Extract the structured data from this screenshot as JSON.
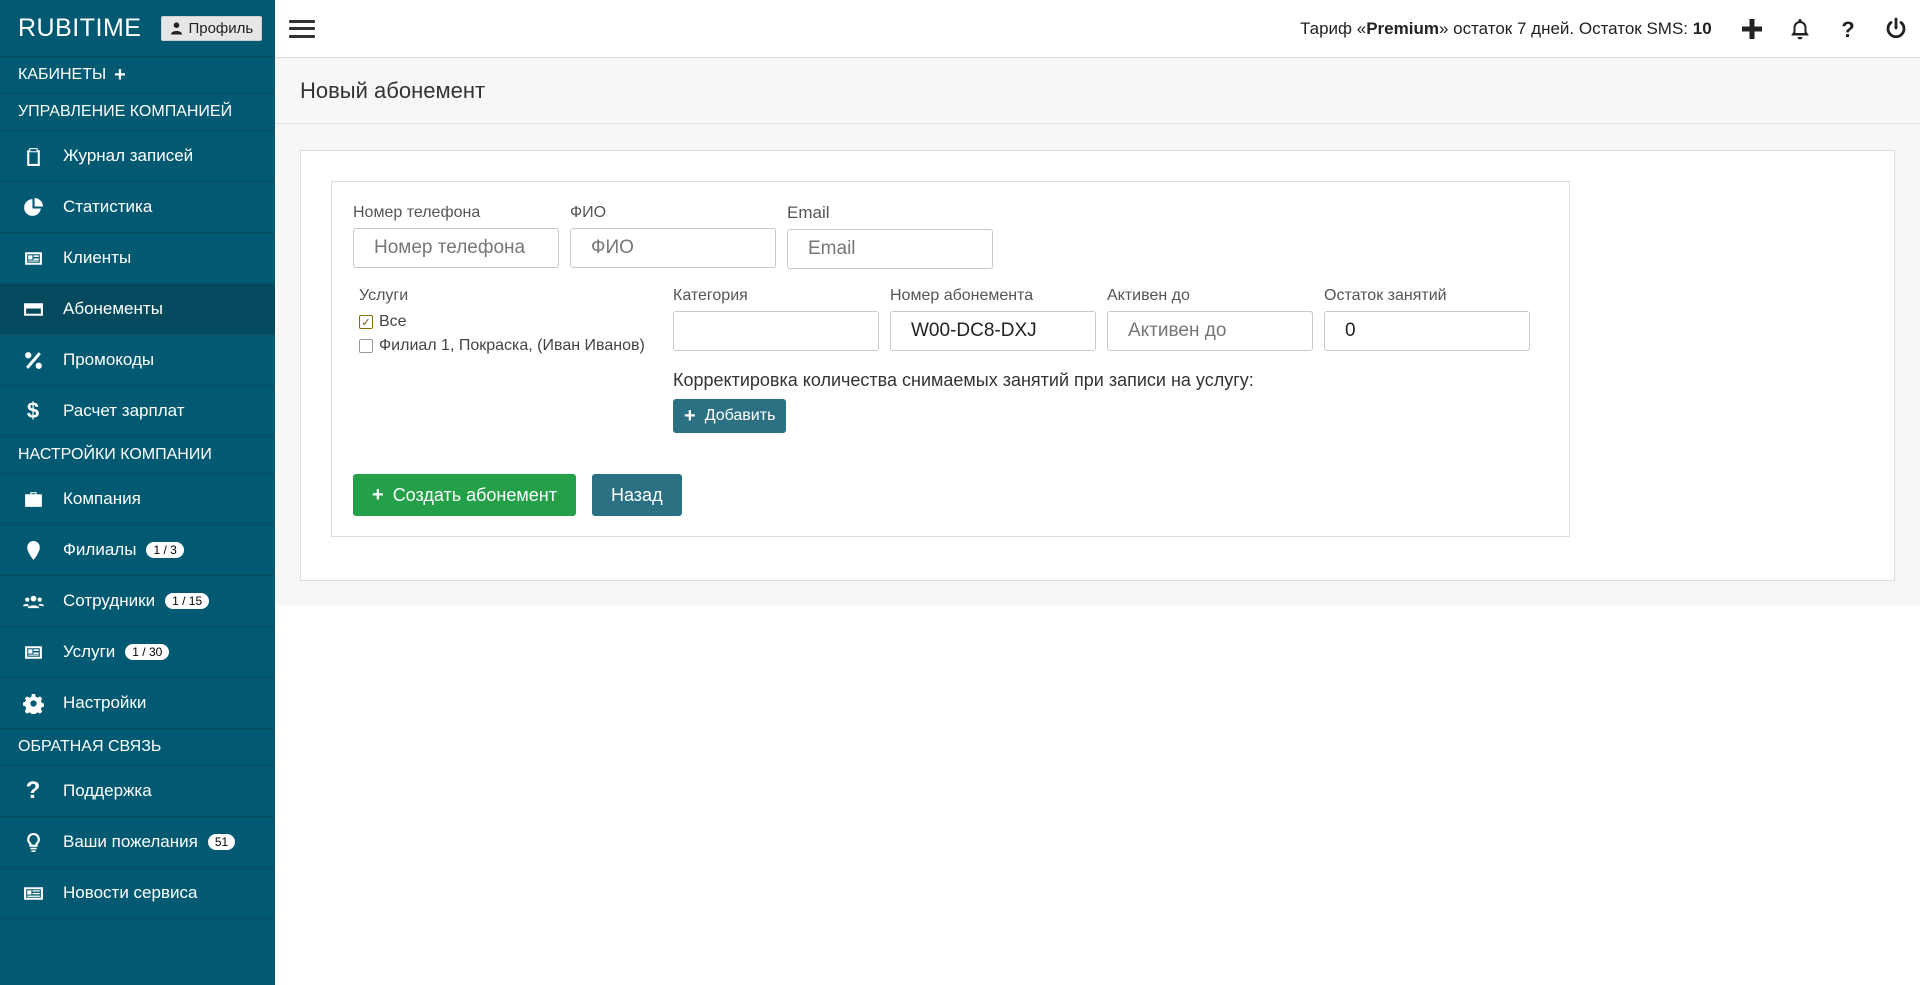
{
  "sidebar": {
    "brand": "RUBITIME",
    "profile_label": "Профиль",
    "cabinets_label": "КАБИНЕТЫ",
    "sections": [
      {
        "title": "УПРАВЛЕНИЕ КОМПАНИЕЙ",
        "items": [
          {
            "label": "Журнал записей",
            "icon": "clipboard-icon"
          },
          {
            "label": "Статистика",
            "icon": "pie-chart-icon"
          },
          {
            "label": "Клиенты",
            "icon": "id-card-icon"
          },
          {
            "label": "Абонементы",
            "icon": "credit-card-icon",
            "active": true
          },
          {
            "label": "Промокоды",
            "icon": "percent-icon"
          },
          {
            "label": "Расчет зарплат",
            "icon": "dollar-icon"
          }
        ]
      },
      {
        "title": "НАСТРОЙКИ КОМПАНИИ",
        "items": [
          {
            "label": "Компания",
            "icon": "briefcase-icon"
          },
          {
            "label": "Филиалы",
            "icon": "map-marker-icon",
            "badge": "1 / 3"
          },
          {
            "label": "Сотрудники",
            "icon": "users-icon",
            "badge": "1 / 15"
          },
          {
            "label": "Услуги",
            "icon": "id-card-icon",
            "badge": "1 / 30"
          },
          {
            "label": "Настройки",
            "icon": "gear-icon"
          }
        ]
      },
      {
        "title": "ОБРАТНАЯ СВЯЗЬ",
        "items": [
          {
            "label": "Поддержка",
            "icon": "question-icon"
          },
          {
            "label": "Ваши пожелания",
            "icon": "lightbulb-icon",
            "badge": "51"
          },
          {
            "label": "Новости сервиса",
            "icon": "newspaper-icon"
          }
        ]
      }
    ]
  },
  "topbar": {
    "tariff_prefix": "Тариф «",
    "tariff_name": "Premium",
    "tariff_suffix": "» остаток 7 дней. Остаток SMS: ",
    "sms_count": "10",
    "icons": [
      "plus-icon",
      "bell-icon",
      "question-icon",
      "power-icon"
    ]
  },
  "page": {
    "title": "Новый абонемент"
  },
  "form": {
    "phone": {
      "label": "Номер телефона",
      "placeholder": "Номер телефона",
      "value": ""
    },
    "fio": {
      "label": "ФИО",
      "placeholder": "ФИО",
      "value": ""
    },
    "email": {
      "label": "Email",
      "placeholder": "Email",
      "value": ""
    },
    "services_label": "Услуги",
    "services": [
      {
        "label": "Все",
        "checked": true
      },
      {
        "label": "Филиал 1, Покраска, (Иван Иванов)",
        "checked": false
      }
    ],
    "category": {
      "label": "Категория",
      "placeholder": "",
      "value": ""
    },
    "number": {
      "label": "Номер абонемента",
      "placeholder": "",
      "value": "W00-DC8-DXJ"
    },
    "active_until": {
      "label": "Активен до",
      "placeholder": "Активен до",
      "value": ""
    },
    "remaining": {
      "label": "Остаток занятий",
      "placeholder": "",
      "value": "0"
    },
    "correction_text": "Корректировка количества снимаемых занятий при записи на услугу:",
    "add_label": "Добавить",
    "create_label": "Создать абонемент",
    "back_label": "Назад"
  },
  "colors": {
    "sidebar_bg": "#015a72",
    "primary": "#2c7183",
    "success": "#24a148"
  }
}
